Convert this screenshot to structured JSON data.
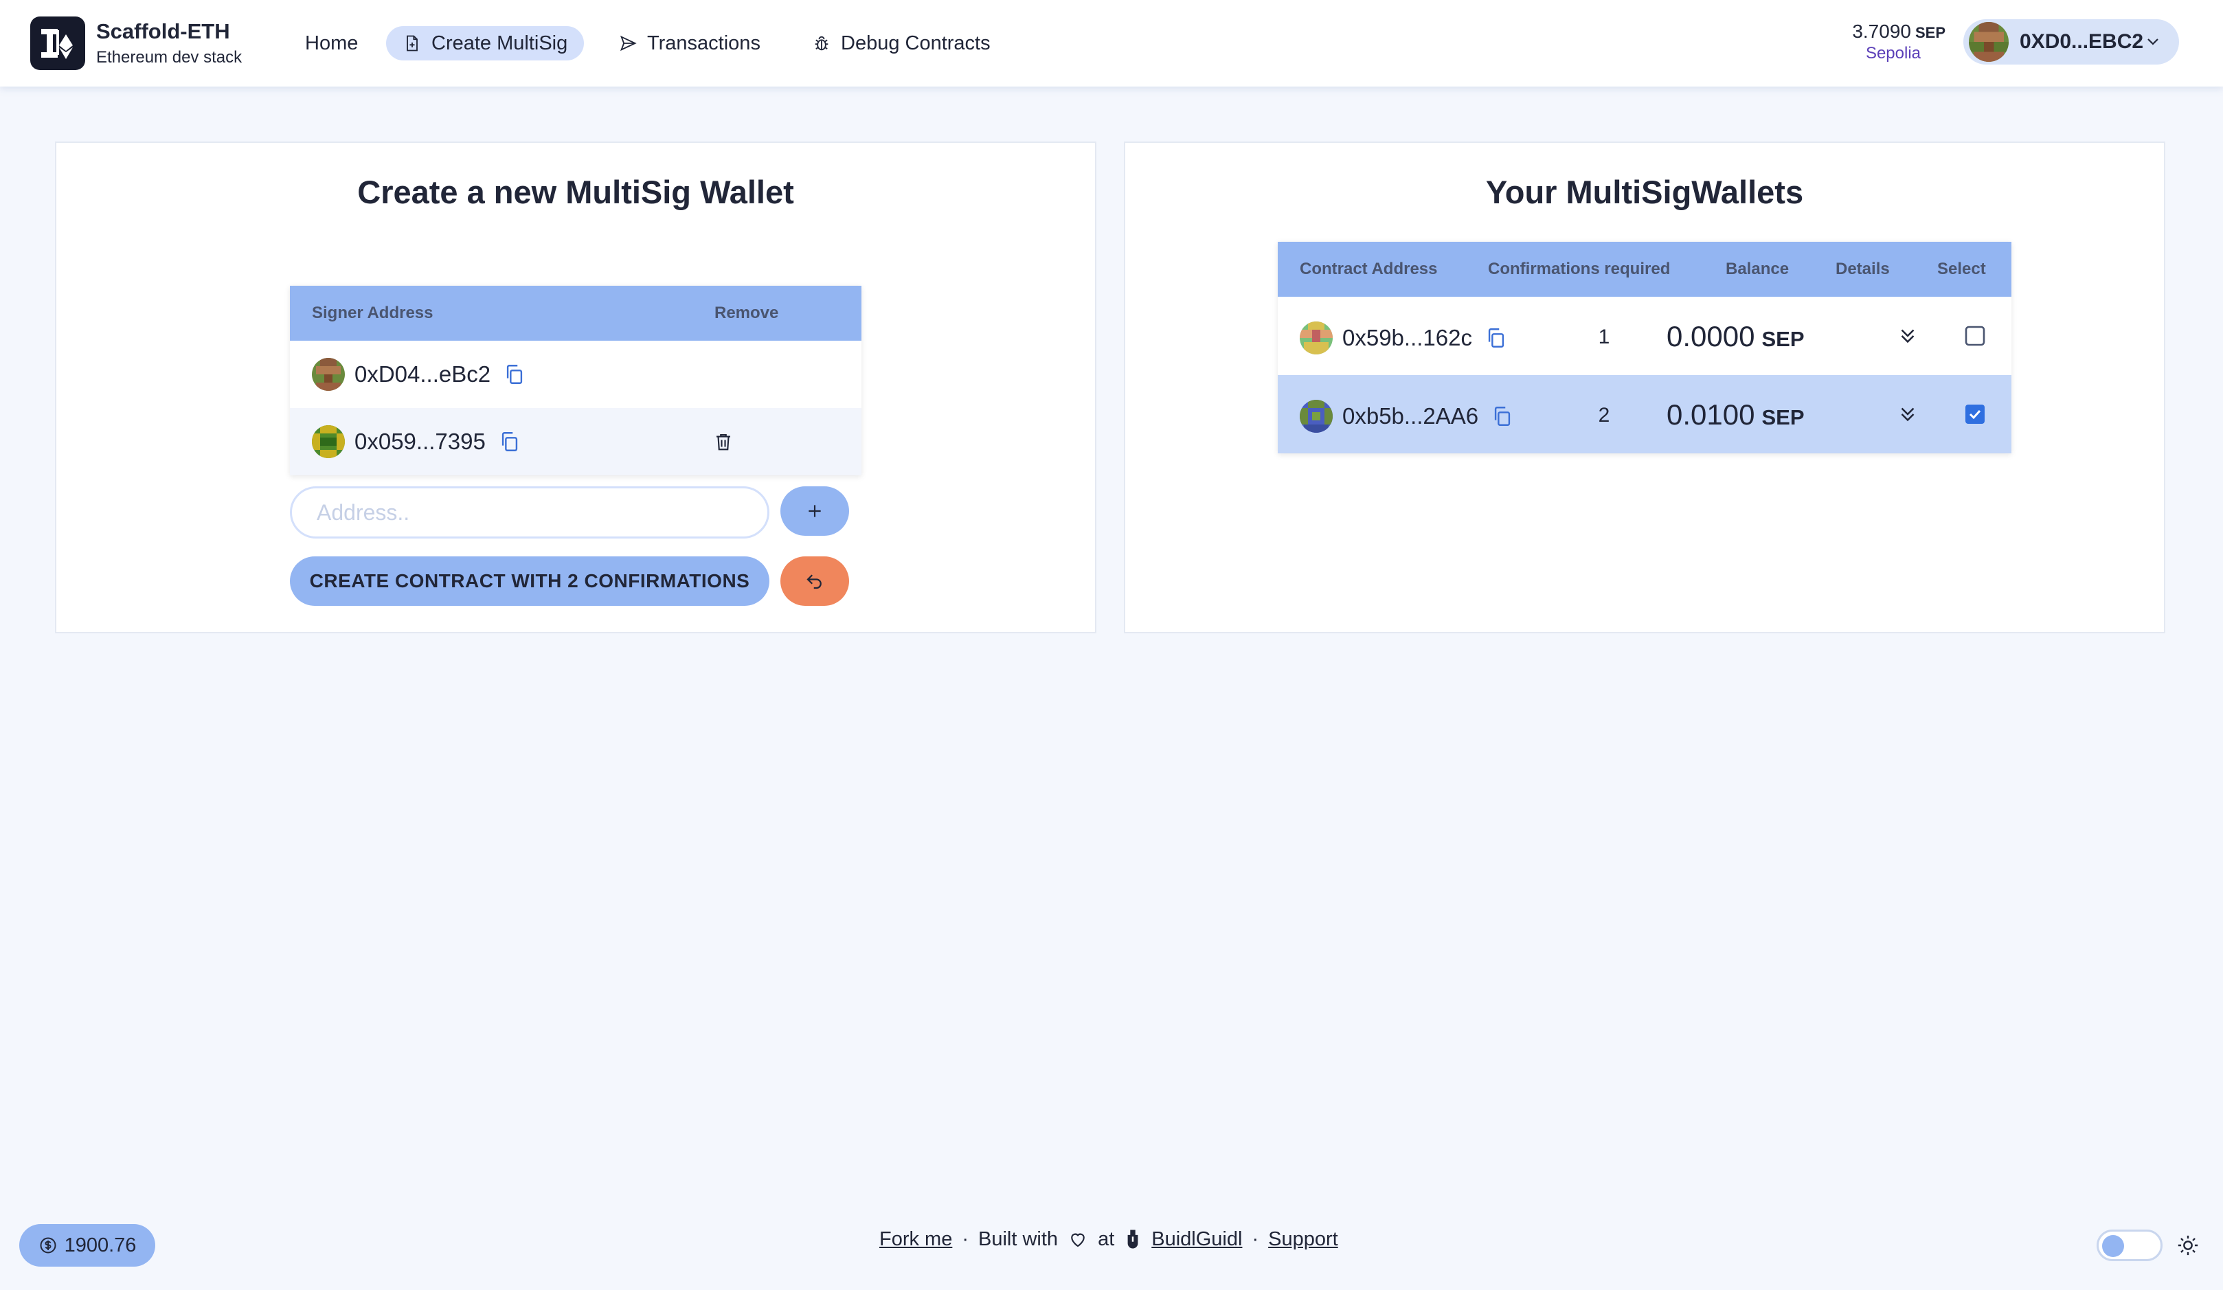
{
  "app": {
    "brand_name": "Scaffold-ETH",
    "brand_sub": "Ethereum dev stack",
    "logo_icon": "scaffold-eth-logo"
  },
  "nav": [
    {
      "label": "Home",
      "icon": "",
      "active": false
    },
    {
      "label": "Create MultiSig",
      "icon": "document-plus-icon",
      "active": true
    },
    {
      "label": "Transactions",
      "icon": "paper-plane-icon",
      "active": false
    },
    {
      "label": "Debug Contracts",
      "icon": "bug-icon",
      "active": false
    }
  ],
  "account": {
    "balance": "3.7090",
    "balance_unit": "SEP",
    "network": "Sepolia",
    "address": "0XD0...EBC2"
  },
  "create_panel": {
    "title": "Create a new MultiSig Wallet",
    "table_headers": {
      "signer": "Signer Address",
      "remove": "Remove"
    },
    "signers": [
      {
        "address": "0xD04...eBc2",
        "removable": false
      },
      {
        "address": "0x059...7395",
        "removable": true
      }
    ],
    "address_placeholder": "Address..",
    "create_label": "CREATE CONTRACT WITH 2 CONFIRMATIONS"
  },
  "wallets_panel": {
    "title": "Your MultiSigWallets",
    "table_headers": {
      "address": "Contract Address",
      "confirmations": "Confirmations required",
      "balance": "Balance",
      "details": "Details",
      "select": "Select"
    },
    "wallets": [
      {
        "address": "0x59b...162c",
        "confirmations": "1",
        "balance": "0.0000",
        "unit": "SEP",
        "selected": false
      },
      {
        "address": "0xb5b...2AA6",
        "confirmations": "2",
        "balance": "0.0100",
        "unit": "SEP",
        "selected": true
      }
    ]
  },
  "footer": {
    "price": "1900.76",
    "fork": "Fork me",
    "built_with": "Built with",
    "at": "at",
    "buidlguidl": "BuidlGuidl",
    "support": "Support",
    "sep": "·"
  },
  "colors": {
    "primary": "#93b5f2",
    "secondary": "#d4e0fb",
    "accent": "#f0865c",
    "bg": "#f4f7fd",
    "text": "#212638"
  }
}
